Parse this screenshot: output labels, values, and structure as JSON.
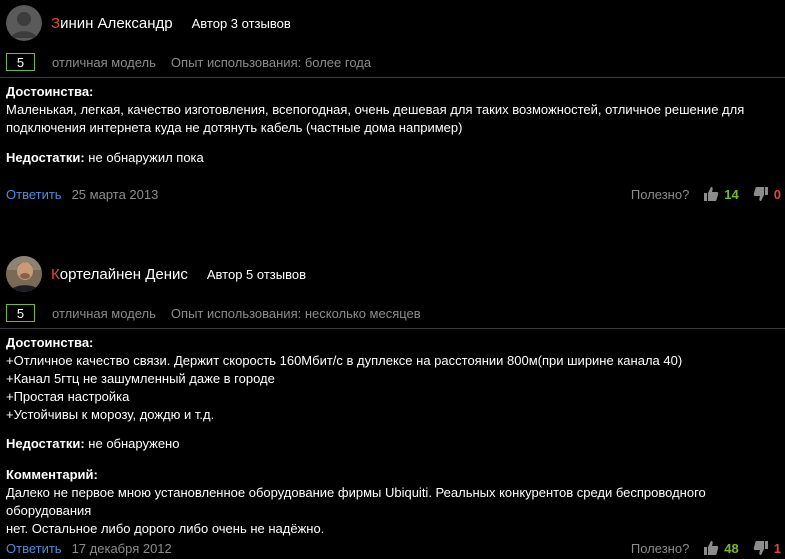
{
  "reviews": [
    {
      "author": {
        "first_letter": "З",
        "rest": "инин Александр"
      },
      "author_stats": "Автор 3 отзывов",
      "grade": "5",
      "grade_text": "отличная модель",
      "usage": "Опыт использования: более года",
      "pros_label": "Достоинства:",
      "pros_lines": [
        "Маленькая, легкая, качество изготовления, всепогодная, очень дешевая для таких возможностей, отличное решение для",
        "подключения интернета куда не дотянуть кабель (частные дома например)"
      ],
      "cons_label": "Недостатки:",
      "cons_text": "не обнаружил пока",
      "reply": "Ответить",
      "date": "25 марта 2013",
      "useful_label": "Полезно?",
      "votes_up": "14",
      "votes_down": "0"
    },
    {
      "author": {
        "first_letter": "К",
        "rest": "ортелайнен Денис"
      },
      "author_stats": "Автор 5 отзывов",
      "grade": "5",
      "grade_text": "отличная модель",
      "usage": "Опыт использования: несколько месяцев",
      "pros_label": "Достоинства:",
      "pros_lines": [
        "+Отличное качество связи. Держит скорость 160Мбит/с в дуплексе на расстоянии 800м(при ширине канала 40)",
        "+Канал 5гтц не зашумленный даже в городе",
        "+Простая настройка",
        "+Устойчивы к морозу, дождю и т.д."
      ],
      "cons_label": "Недостатки:",
      "cons_text": "не обнаружено",
      "comment_label": "Комментарий:",
      "comment_lines": [
        "Далеко не первое мною установленное оборудование фирмы Ubiquiti. Реальных конкурентов среди беспроводного оборудования",
        "нет. Остальное либо дорого либо очень не надёжно."
      ],
      "reply": "Ответить",
      "date": "17 декабря 2012",
      "useful_label": "Полезно?",
      "votes_up": "48",
      "votes_down": "1"
    }
  ],
  "colors": {
    "accent_red": "#e0483f",
    "link_blue": "#4d8cd9",
    "positive_green": "#7ab828",
    "muted_gray": "#8c8c8c"
  },
  "icons": {
    "thumb_up": "thumbs-up-icon",
    "thumb_down": "thumbs-down-icon",
    "avatar_default": "default-avatar-icon"
  }
}
